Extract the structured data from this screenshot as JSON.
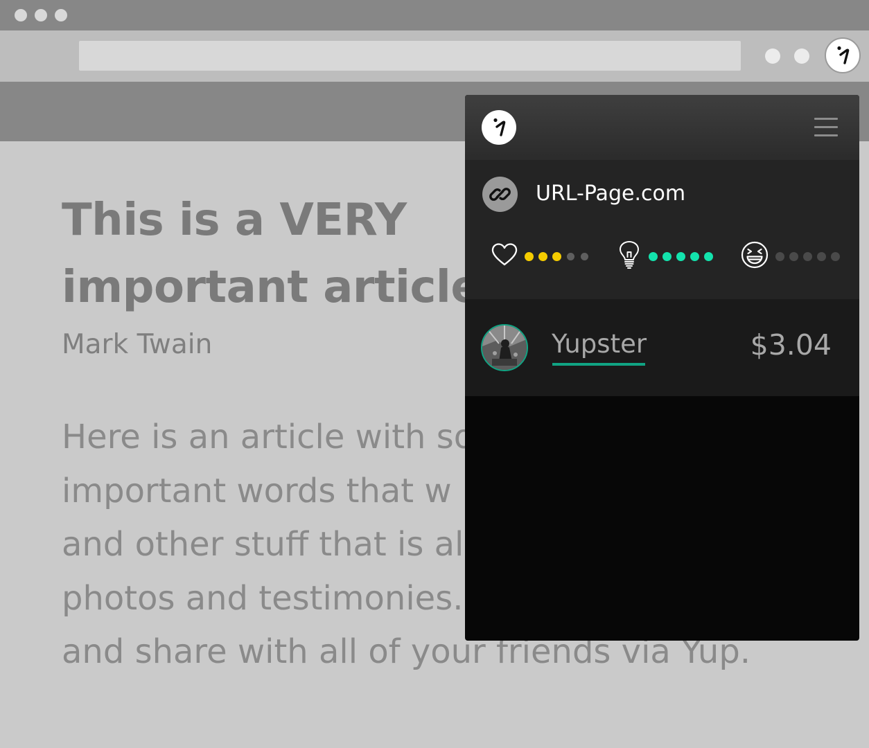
{
  "browser": {
    "window_controls": [
      "close",
      "minimize",
      "maximize"
    ],
    "address_bar": {
      "value": ""
    },
    "extension_icon": "yup-logo-icon"
  },
  "article": {
    "title_lines": [
      "This is a VERY",
      "important article"
    ],
    "author": "Mark Twain",
    "body_lines": [
      "Here is an article with so",
      "important words that w",
      "and other stuff that is al",
      "photos and testimonies.",
      "and share with all of your friends via Yup."
    ]
  },
  "popup": {
    "logo": "yup-logo-icon",
    "menu_icon": "hamburger-menu-icon",
    "site": {
      "icon": "link-icon",
      "url": "URL-Page.com"
    },
    "ratings": [
      {
        "category": "like",
        "icon": "heart-icon",
        "level": 3,
        "max": 5,
        "color": "#f5cc00"
      },
      {
        "category": "idea",
        "icon": "lightbulb-icon",
        "level": 5,
        "max": 5,
        "color": "#13e3ad"
      },
      {
        "category": "funny",
        "icon": "laughing-face-icon",
        "level": 0,
        "max": 5,
        "color": "#4a4a4a"
      }
    ],
    "user": {
      "name": "Yupster",
      "balance": "$3.04",
      "accent": "#10a383"
    }
  }
}
